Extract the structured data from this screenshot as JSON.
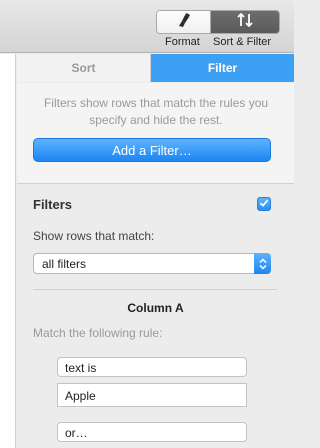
{
  "toolbar": {
    "format_label": "Format",
    "format_icon": "paintbrush-icon",
    "sort_filter_label": "Sort & Filter",
    "sort_filter_icon": "sort-arrows-icon"
  },
  "tabs": [
    {
      "label": "Sort",
      "active": false
    },
    {
      "label": "Filter",
      "active": true
    }
  ],
  "description": "Filters show rows that match the rules you specify and hide the rest.",
  "add_filter_label": "Add a Filter…",
  "filters": {
    "title": "Filters",
    "enabled": true,
    "match_label": "Show rows that match:",
    "match_value": "all filters"
  },
  "rule": {
    "column_title": "Column A",
    "match_label": "Match the following rule:",
    "condition": "text is",
    "value": "Apple",
    "or_label": "or…"
  },
  "colors": {
    "accent": "#3ea0f5",
    "button": "#1c86f1"
  }
}
